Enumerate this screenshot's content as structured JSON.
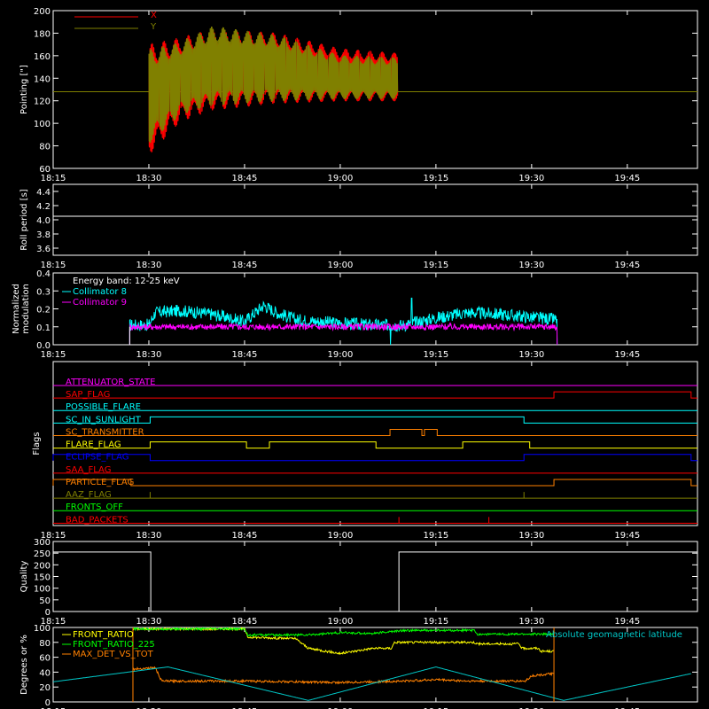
{
  "chart_data": [
    {
      "type": "line",
      "ylabel": "Pointing [\"]",
      "ylim": [
        60,
        200
      ],
      "yticks": [
        60,
        80,
        100,
        120,
        140,
        160,
        180,
        200
      ],
      "xticks": [
        "18:15",
        "18:30",
        "18:45",
        "19:00",
        "19:15",
        "19:30",
        "19:45"
      ],
      "xlim_minutes": [
        0,
        45
      ],
      "legend": [
        {
          "label": "X",
          "color": "#ff0000"
        },
        {
          "label": "Y",
          "color": "#808000"
        }
      ],
      "series": [
        {
          "name": "X",
          "color": "#ff0000",
          "x_start": "18:30",
          "x_end": "19:09",
          "min_envelope": [
            [
              0,
              72
            ],
            [
              5,
              102
            ],
            [
              10,
              112
            ],
            [
              20,
              118
            ],
            [
              30,
              120
            ],
            [
              39,
              120
            ]
          ],
          "max_envelope": [
            [
              0,
              170
            ],
            [
              5,
              176
            ],
            [
              10,
              183
            ],
            [
              20,
              180
            ],
            [
              30,
              166
            ],
            [
              39,
              162
            ]
          ]
        },
        {
          "name": "Y",
          "color": "#808000",
          "x_start": "18:30",
          "x_end": "19:09",
          "min_envelope": [
            [
              0,
              82
            ],
            [
              5,
              108
            ],
            [
              10,
              116
            ],
            [
              20,
              120
            ],
            [
              30,
              122
            ],
            [
              39,
              122
            ]
          ],
          "max_envelope": [
            [
              0,
              165
            ],
            [
              5,
              172
            ],
            [
              10,
              186
            ],
            [
              20,
              178
            ],
            [
              30,
              160
            ],
            [
              39,
              158
            ]
          ]
        },
        {
          "name": "reference",
          "color": "#808000",
          "value": 128
        }
      ]
    },
    {
      "type": "line",
      "ylabel": "Roll period [s]",
      "ylim": [
        3.5,
        4.5
      ],
      "yticks": [
        3.6,
        3.8,
        4.0,
        4.2,
        4.4
      ],
      "xticks": [
        "18:15",
        "18:30",
        "18:45",
        "19:00",
        "19:15",
        "19:30",
        "19:45"
      ],
      "series": [
        {
          "color": "#ffffff",
          "value": 4.05
        }
      ]
    },
    {
      "type": "line",
      "ylabel": "Normalized modulation",
      "ylim": [
        0,
        0.4
      ],
      "yticks": [
        0.0,
        0.1,
        0.2,
        0.3,
        0.4
      ],
      "xticks": [
        "18:15",
        "18:30",
        "18:45",
        "19:00",
        "19:15",
        "19:30",
        "19:45"
      ],
      "annotation": "Energy band: 12-25 keV",
      "legend": [
        {
          "label": "Collimator 8",
          "color": "#00ffff"
        },
        {
          "label": "Collimator 9",
          "color": "#ff00ff"
        }
      ],
      "series": [
        {
          "name": "Collimator 8",
          "color": "#00ffff",
          "x_start": "18:27",
          "x_end": "19:34",
          "profile": [
            [
              12,
              0.11
            ],
            [
              15,
              0.11
            ],
            [
              16,
              0.18
            ],
            [
              20,
              0.19
            ],
            [
              25,
              0.17
            ],
            [
              30,
              0.13
            ],
            [
              33,
              0.22
            ],
            [
              35,
              0.18
            ],
            [
              38,
              0.14
            ],
            [
              45,
              0.12
            ],
            [
              50,
              0.11
            ],
            [
              55,
              0.11
            ],
            [
              60,
              0.15
            ],
            [
              65,
              0.18
            ],
            [
              70,
              0.17
            ],
            [
              79,
              0.14
            ]
          ]
        },
        {
          "name": "Collimator 9",
          "color": "#ff00ff",
          "x_start": "18:27",
          "x_end": "19:34",
          "profile": [
            [
              12,
              0.1
            ],
            [
              79,
              0.1
            ]
          ]
        }
      ]
    },
    {
      "type": "line",
      "ylabel": "Flags",
      "xticks": [
        "18:15",
        "18:30",
        "18:45",
        "19:00",
        "19:15",
        "19:30",
        "19:45"
      ],
      "series": [
        {
          "name": "ATTENUATOR_STATE",
          "color": "#ff00ff",
          "segments": []
        },
        {
          "name": "SAP_FLAG",
          "color": "#ff0000",
          "segments": [
            [
              78.5,
              100
            ]
          ]
        },
        {
          "name": "POSSIBLE_FLARE",
          "color": "#00ffff",
          "segments": []
        },
        {
          "name": "SC_IN_SUNLIGHT",
          "color": "#00ffff",
          "segments": [
            [
              15.2,
              73.8
            ]
          ]
        },
        {
          "name": "SC_TRANSMITTER",
          "color": "#ff8000",
          "segments": [
            [
              52.8,
              57.8
            ],
            [
              58.2,
              60.2
            ]
          ]
        },
        {
          "name": "FLARE_FLAG",
          "color": "#ffff00",
          "segments": [
            [
              15.2,
              30.3
            ],
            [
              33.9,
              50.6
            ],
            [
              64.2,
              74.7
            ]
          ]
        },
        {
          "name": "ECLIPSE_FLAG",
          "color": "#0000ff",
          "segments": [
            [
              0,
              15.2
            ],
            [
              73.8,
              100
            ]
          ]
        },
        {
          "name": "SAA_FLAG",
          "color": "#ff0000",
          "segments": []
        },
        {
          "name": "PARTICLE_FLAG",
          "color": "#ff8000",
          "segments": [
            [
              0,
              12.2
            ],
            [
              78.5,
              100
            ]
          ]
        },
        {
          "name": "AAZ_FLAG",
          "color": "#808000",
          "spikes": [
            15.2,
            73.8
          ]
        },
        {
          "name": "FRONTS_OFF",
          "color": "#00ff00",
          "segments": []
        },
        {
          "name": "BAD_PACKETS",
          "color": "#ff0000",
          "spikes": [
            54.2,
            68.3
          ]
        }
      ]
    },
    {
      "type": "line",
      "ylabel": "Quality",
      "ylim": [
        0,
        300
      ],
      "yticks": [
        0,
        50,
        100,
        150,
        200,
        250,
        300
      ],
      "xticks": [
        "18:15",
        "18:30",
        "18:45",
        "19:00",
        "19:15",
        "19:30",
        "19:45"
      ],
      "series": [
        {
          "color": "#ffffff",
          "steps": [
            [
              0,
              255
            ],
            [
              15.3,
              0
            ],
            [
              54.2,
              255
            ],
            [
              100,
              255
            ]
          ]
        }
      ]
    },
    {
      "type": "line",
      "ylabel": "Degrees or %",
      "ylim": [
        0,
        100
      ],
      "yticks": [
        0,
        20,
        40,
        60,
        80,
        100
      ],
      "xticks": [
        "18:15",
        "18:30",
        "18:45",
        "19:00",
        "19:15",
        "19:30",
        "19:45"
      ],
      "legend": [
        {
          "label": "FRONT_RATIO",
          "color": "#ffff00"
        },
        {
          "label": "FRONT_RATIO_225",
          "color": "#00ff00"
        },
        {
          "label": "MAX_DET_VS_TOT",
          "color": "#ff8000"
        },
        {
          "label": "Absolute geomagnetic latitude",
          "color": "#00c8c8"
        }
      ],
      "series": [
        {
          "name": "FRONT_RATIO",
          "color": "#ffff00",
          "profile": [
            [
              12.5,
              98
            ],
            [
              30,
              98
            ],
            [
              30.5,
              87
            ],
            [
              38,
              85
            ],
            [
              40,
              72
            ],
            [
              45,
              65
            ],
            [
              50,
              72
            ],
            [
              53,
              72
            ],
            [
              53.5,
              80
            ],
            [
              66,
              80
            ],
            [
              66.5,
              78
            ],
            [
              73,
              78
            ],
            [
              73.5,
              72
            ],
            [
              76,
              72
            ],
            [
              76.5,
              68
            ],
            [
              78.5,
              68
            ]
          ]
        },
        {
          "name": "FRONT_RATIO_225",
          "color": "#00ff00",
          "profile": [
            [
              12.5,
              98
            ],
            [
              30,
              98
            ],
            [
              30.5,
              90
            ],
            [
              40,
              90
            ],
            [
              45,
              93
            ],
            [
              50,
              92
            ],
            [
              55,
              96
            ],
            [
              66,
              96
            ],
            [
              66.5,
              91
            ],
            [
              78.5,
              91
            ]
          ]
        },
        {
          "name": "MAX_DET_VS_TOT",
          "color": "#ff8000",
          "profile": [
            [
              12.5,
              44
            ],
            [
              16,
              46
            ],
            [
              17,
              28
            ],
            [
              30,
              28
            ],
            [
              45,
              26
            ],
            [
              55,
              28
            ],
            [
              60,
              30
            ],
            [
              65,
              28
            ],
            [
              72,
              28
            ],
            [
              74,
              28
            ],
            [
              75,
              35
            ],
            [
              78.5,
              38
            ]
          ]
        },
        {
          "name": "Absolute geomagnetic latitude",
          "color": "#00c8c8",
          "profile": [
            [
              0,
              27
            ],
            [
              18,
              47
            ],
            [
              40,
              2
            ],
            [
              60,
              47
            ],
            [
              80,
              2
            ],
            [
              100,
              38
            ]
          ]
        }
      ]
    }
  ]
}
